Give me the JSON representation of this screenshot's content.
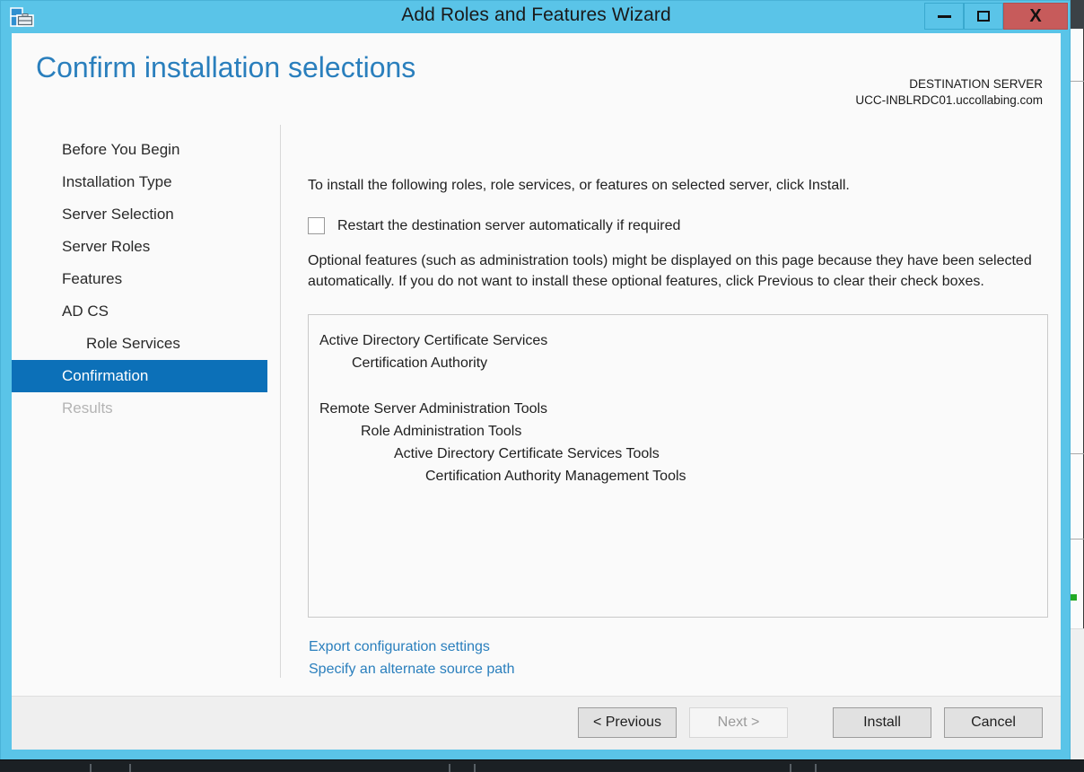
{
  "window": {
    "title": "Add Roles and Features Wizard",
    "icon": "server-manager-icon",
    "controls": {
      "minimize": "minimize-icon",
      "maximize": "maximize-icon",
      "close": "X"
    }
  },
  "header": {
    "page_title": "Confirm installation selections",
    "destination_label": "DESTINATION SERVER",
    "destination_server": "UCC-INBLRDC01.uccollabing.com"
  },
  "nav": {
    "items": [
      {
        "label": "Before You Begin",
        "state": "normal",
        "level": 0
      },
      {
        "label": "Installation Type",
        "state": "normal",
        "level": 0
      },
      {
        "label": "Server Selection",
        "state": "normal",
        "level": 0
      },
      {
        "label": "Server Roles",
        "state": "normal",
        "level": 0
      },
      {
        "label": "Features",
        "state": "normal",
        "level": 0
      },
      {
        "label": "AD CS",
        "state": "normal",
        "level": 0
      },
      {
        "label": "Role Services",
        "state": "normal",
        "level": 1
      },
      {
        "label": "Confirmation",
        "state": "selected",
        "level": 0
      },
      {
        "label": "Results",
        "state": "disabled",
        "level": 0
      }
    ]
  },
  "content": {
    "intro": "To install the following roles, role services, or features on selected server, click Install.",
    "restart_checkbox_label": "Restart the destination server automatically if required",
    "restart_checkbox_checked": false,
    "optional_note": "Optional features (such as administration tools) might be displayed on this page because they have been selected automatically. If you do not want to install these optional features, click Previous to clear their check boxes.",
    "feature_list": [
      {
        "label": "Active Directory Certificate Services",
        "level": 0
      },
      {
        "label": "Certification Authority",
        "level": 1
      },
      {
        "label": "",
        "level": -1
      },
      {
        "label": "Remote Server Administration Tools",
        "level": 0
      },
      {
        "label": "Role Administration Tools",
        "level": 2
      },
      {
        "label": "Active Directory Certificate Services Tools",
        "level": 3
      },
      {
        "label": "Certification Authority Management Tools",
        "level": 4
      }
    ],
    "links": [
      "Export configuration settings",
      "Specify an alternate source path"
    ]
  },
  "footer": {
    "previous_label": "< Previous",
    "next_label": "Next >",
    "next_enabled": false,
    "install_label": "Install",
    "cancel_label": "Cancel"
  },
  "colors": {
    "titlebar": "#5ac4e8",
    "accent_link": "#2a7fbd",
    "selection": "#0c70b8",
    "close_button": "#c75b5b",
    "client_background": "#fafafa",
    "footer_background": "#efefef"
  }
}
